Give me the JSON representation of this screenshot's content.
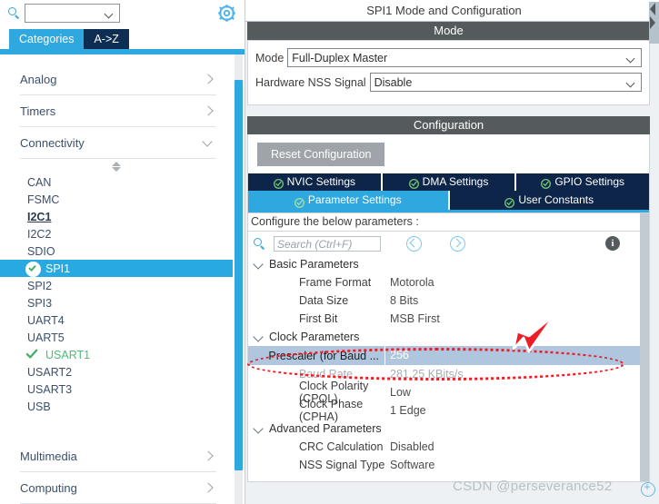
{
  "left_panel": {
    "search": {
      "placeholder": "",
      "value": "",
      "icon": "search-icon"
    },
    "gear_icon": "gear-icon",
    "tabs": [
      {
        "label": "Categories",
        "selected": true
      },
      {
        "label": "A->Z",
        "selected": false
      }
    ],
    "categories": [
      {
        "label": "Analog",
        "expanded": false,
        "chevron": "chevron-right-icon"
      },
      {
        "label": "Timers",
        "expanded": false,
        "chevron": "chevron-right-icon"
      },
      {
        "label": "Connectivity",
        "expanded": true,
        "chevron": "chevron-down-icon"
      }
    ],
    "peripherals": [
      {
        "label": "CAN",
        "state": "none"
      },
      {
        "label": "FSMC",
        "state": "none"
      },
      {
        "label": "I2C1",
        "state": "bold"
      },
      {
        "label": "I2C2",
        "state": "none"
      },
      {
        "label": "SDIO",
        "state": "none"
      },
      {
        "label": "SPI1",
        "state": "selected-configured"
      },
      {
        "label": "SPI2",
        "state": "none"
      },
      {
        "label": "SPI3",
        "state": "none"
      },
      {
        "label": "UART4",
        "state": "none"
      },
      {
        "label": "UART5",
        "state": "none"
      },
      {
        "label": "USART1",
        "state": "configured"
      },
      {
        "label": "USART2",
        "state": "none"
      },
      {
        "label": "USART3",
        "state": "none"
      },
      {
        "label": "USB",
        "state": "none"
      }
    ],
    "categories_bottom": [
      {
        "label": "Multimedia",
        "expanded": false,
        "chevron": "chevron-right-icon"
      },
      {
        "label": "Computing",
        "expanded": false,
        "chevron": "chevron-right-icon"
      }
    ]
  },
  "right_panel": {
    "title": "SPI1 Mode and Configuration",
    "mode_section": {
      "header": "Mode",
      "fields": [
        {
          "label": "Mode",
          "value": "Full-Duplex Master"
        },
        {
          "label": "Hardware NSS Signal",
          "value": "Disable"
        }
      ]
    },
    "configuration_section": {
      "header": "Configuration",
      "reset_button": "Reset Configuration",
      "tabs_row1": [
        {
          "label": "NVIC Settings",
          "active": false
        },
        {
          "label": "DMA Settings",
          "active": false
        },
        {
          "label": "GPIO Settings",
          "active": false
        }
      ],
      "tabs_row2": [
        {
          "label": "Parameter Settings",
          "active": true
        },
        {
          "label": "User Constants",
          "active": false
        }
      ],
      "configure_hint": "Configure the below parameters :",
      "search_placeholder": "Search (Ctrl+F)",
      "search_value": "",
      "prev_label": "‹",
      "next_label": "›",
      "info_label": "i",
      "groups": [
        {
          "name": "Basic Parameters",
          "rows": [
            {
              "name": "Frame Format",
              "value": "Motorola",
              "style": "normal"
            },
            {
              "name": "Data Size",
              "value": "8 Bits",
              "style": "normal"
            },
            {
              "name": "First Bit",
              "value": "MSB First",
              "style": "normal"
            }
          ]
        },
        {
          "name": "Clock Parameters",
          "rows": [
            {
              "name": "Prescaler (for Baud ...",
              "value": "256",
              "style": "selected"
            },
            {
              "name": "Baud Rate",
              "value": "281.25 KBits/s",
              "style": "dim"
            },
            {
              "name": "Clock Polarity (CPOL)",
              "value": "Low",
              "style": "normal"
            },
            {
              "name": "Clock Phase (CPHA)",
              "value": "1 Edge",
              "style": "normal"
            }
          ]
        },
        {
          "name": "Advanced Parameters",
          "rows": [
            {
              "name": "CRC Calculation",
              "value": "Disabled",
              "style": "normal"
            },
            {
              "name": "NSS Signal Type",
              "value": "Software",
              "style": "normal"
            }
          ]
        }
      ]
    }
  },
  "watermark": {
    "text": "CSDN @perseverance52"
  },
  "colors": {
    "accent_blue": "#2fa8e0",
    "tab_navy": "#0d2548",
    "section_header_gray": "#555a5d",
    "selected_row_blue": "#b0c6de",
    "annotation_red": "#ee1c25",
    "configured_green": "#4fbb77"
  }
}
